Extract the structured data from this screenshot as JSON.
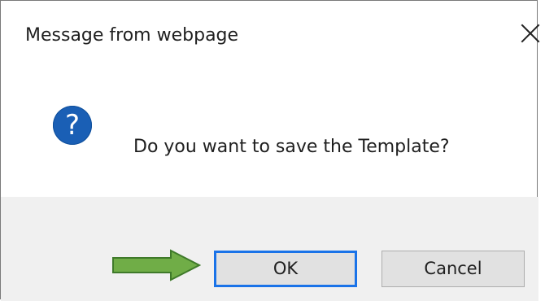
{
  "dialog": {
    "title": "Message from webpage",
    "message": "Do you want to save the Template?",
    "icon_name": "question-icon",
    "ok_label": "OK",
    "cancel_label": "Cancel",
    "close_icon": "close-icon",
    "accent_color": "#1a73e8",
    "question_color": "#1a5fb5",
    "footer_color": "#f0f0f0",
    "button_color": "#e1e1e1",
    "arrow_color": "#70ad47"
  }
}
